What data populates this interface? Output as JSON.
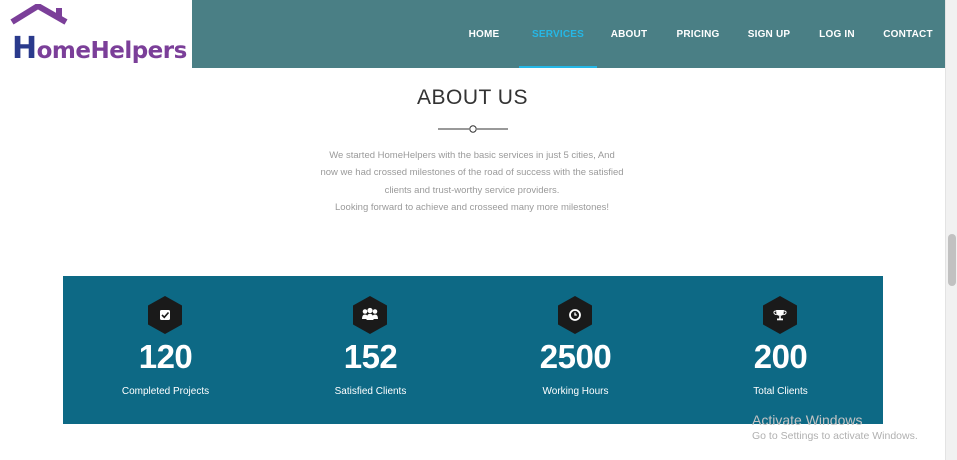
{
  "brand": {
    "name_initial": "H",
    "name_rest": "omeHelpers"
  },
  "nav": {
    "items": [
      {
        "label": "HOME"
      },
      {
        "label": "SERVICES",
        "active": true
      },
      {
        "label": "ABOUT"
      },
      {
        "label": "PRICING"
      },
      {
        "label": "SIGN UP"
      },
      {
        "label": "LOG IN"
      },
      {
        "label": "CONTACT"
      }
    ]
  },
  "about": {
    "title": "ABOUT US",
    "lines": [
      "We started HomeHelpers with the basic services in just 5 cities, And",
      "now we had crossed milestones of the road of success with the satisfied",
      "clients and trust-worthy service providers.",
      "Looking forward to achieve and crosseed many more milestones!"
    ]
  },
  "stats": [
    {
      "icon": "checkbox-icon",
      "value": "120",
      "label": "Completed Projects"
    },
    {
      "icon": "users-icon",
      "value": "152",
      "label": "Satisfied Clients"
    },
    {
      "icon": "clock-icon",
      "value": "2500",
      "label": "Working Hours"
    },
    {
      "icon": "trophy-icon",
      "value": "200",
      "label": "Total Clients"
    }
  ],
  "watermark": {
    "title": "Activate Windows",
    "subtitle": "Go to Settings to activate Windows."
  },
  "colors": {
    "navbar": "#4a7f85",
    "active_nav": "#25b7e6",
    "stats_bg": "#0d6985",
    "logo_purple": "#7b3f99",
    "logo_blue": "#2a3a8c"
  }
}
